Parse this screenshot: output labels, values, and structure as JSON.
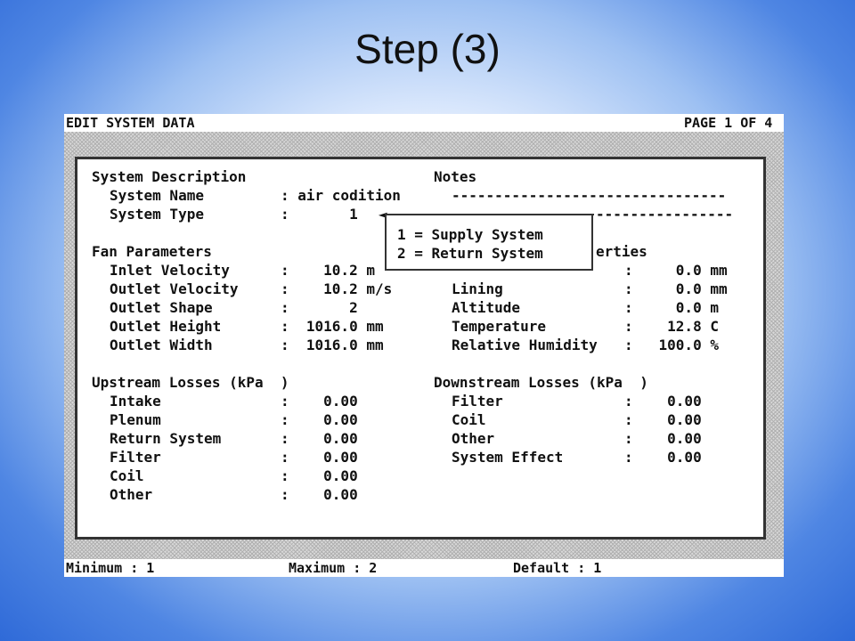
{
  "slide": {
    "title": "Step (3)"
  },
  "header": {
    "title": "EDIT SYSTEM DATA",
    "page": "PAGE 1 OF 4"
  },
  "system": {
    "heading": "System Description",
    "name_label": "System Name",
    "name_value": ": air codition",
    "type_label": "System Type",
    "type_value": ":       1",
    "type_arrow": "◄"
  },
  "notes": {
    "heading": "Notes",
    "line1": "--------------------------------",
    "line2": "----------------"
  },
  "popup": {
    "option1": "1 = Supply System",
    "option2": "2 = Return System"
  },
  "fan": {
    "heading": "Fan Parameters",
    "rows": [
      {
        "label": "Inlet Velocity",
        "value": ":    10.2 m"
      },
      {
        "label": "Outlet Velocity",
        "value": ":    10.2 m/s"
      },
      {
        "label": "Outlet Shape",
        "value": ":       2"
      },
      {
        "label": "Outlet Height",
        "value": ":  1016.0 mm"
      },
      {
        "label": "Outlet Width",
        "value": ":  1016.0 mm"
      }
    ]
  },
  "properties": {
    "heading_fragment": "erties",
    "rows": [
      {
        "label": "",
        "value": ":     0.0 mm"
      },
      {
        "label": "Lining",
        "value": ":     0.0 mm"
      },
      {
        "label": "Altitude",
        "value": ":     0.0 m"
      },
      {
        "label": "Temperature",
        "value": ":    12.8 C"
      },
      {
        "label": "Relative Humidity",
        "value": ":   100.0 %"
      }
    ]
  },
  "upstream": {
    "heading": "Upstream Losses (kPa  )",
    "rows": [
      {
        "label": "Intake",
        "value": ":    0.00"
      },
      {
        "label": "Plenum",
        "value": ":    0.00"
      },
      {
        "label": "Return System",
        "value": ":    0.00"
      },
      {
        "label": "Filter",
        "value": ":    0.00"
      },
      {
        "label": "Coil",
        "value": ":    0.00"
      },
      {
        "label": "Other",
        "value": ":    0.00"
      }
    ]
  },
  "downstream": {
    "heading": "Downstream Losses (kPa  )",
    "rows": [
      {
        "label": "Filter",
        "value": ":    0.00"
      },
      {
        "label": "Coil",
        "value": ":    0.00"
      },
      {
        "label": "Other",
        "value": ":    0.00"
      },
      {
        "label": "System Effect",
        "value": ":    0.00"
      }
    ]
  },
  "footer": {
    "minimum": "Minimum : 1",
    "maximum": "Maximum : 2",
    "default": "Default : 1"
  }
}
